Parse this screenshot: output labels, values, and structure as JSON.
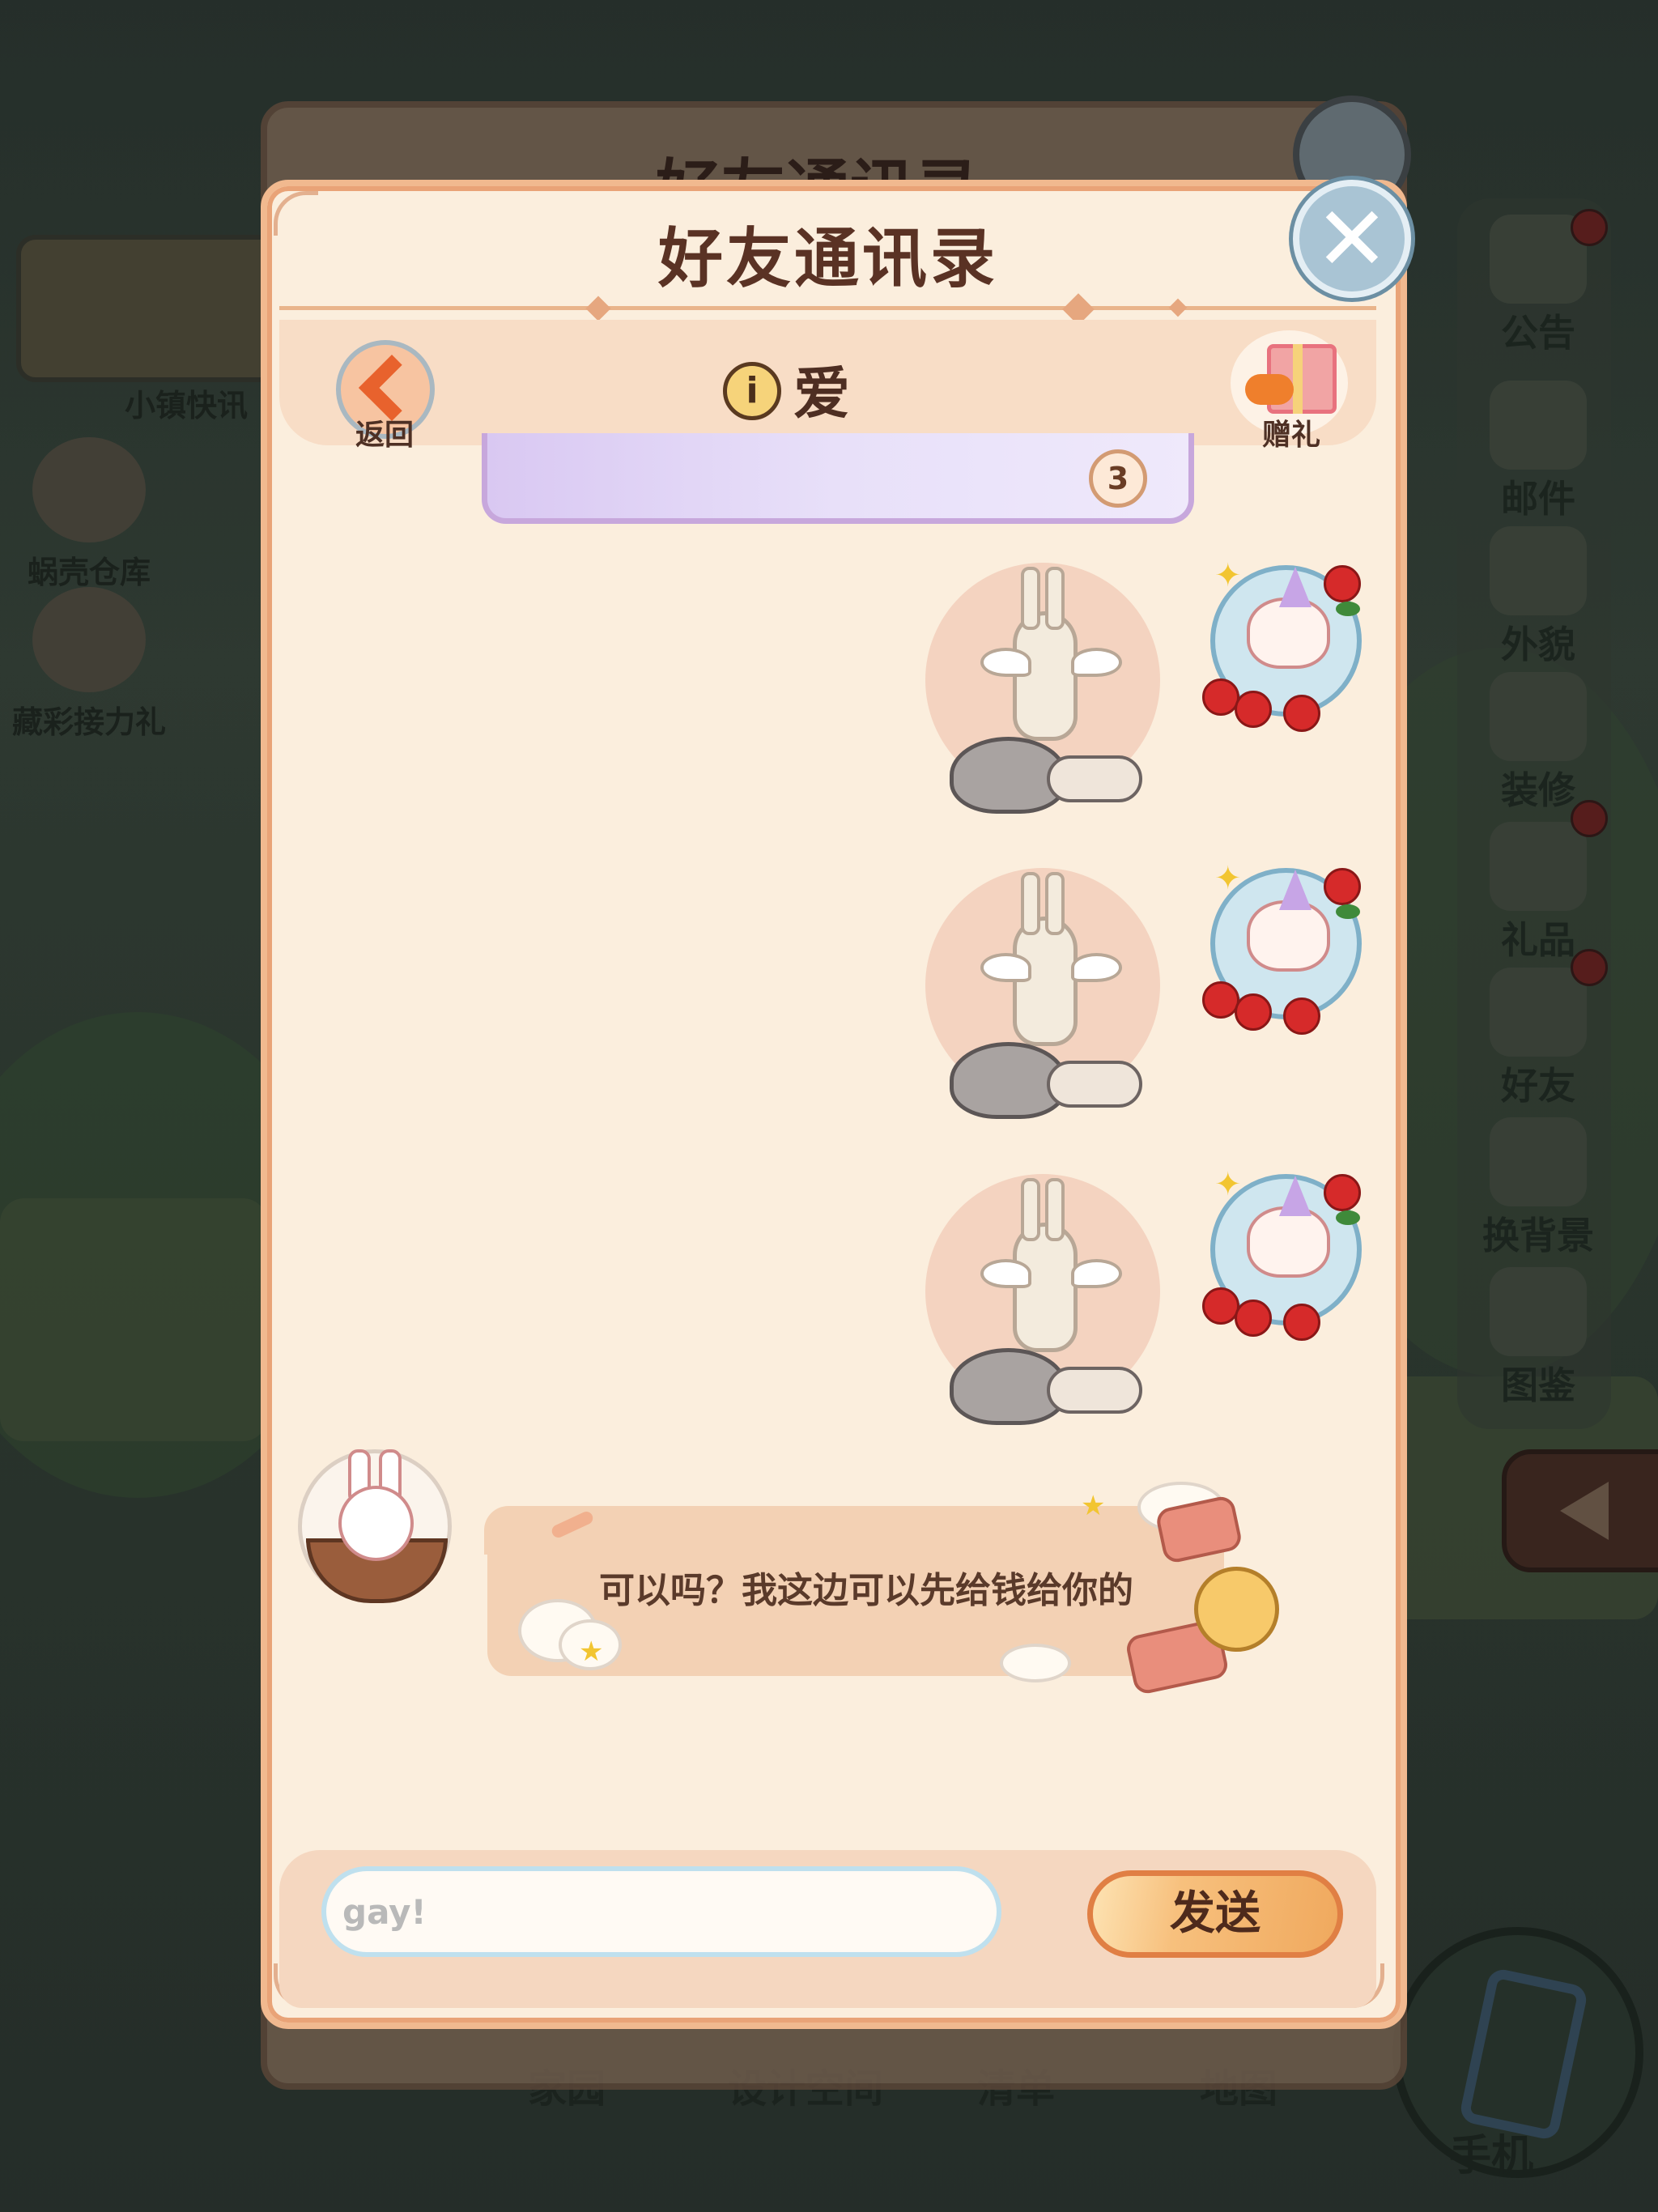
{
  "background": {
    "news_label": "小镇快讯",
    "left_items": [
      "蜗壳仓库",
      "藏彩接力礼"
    ],
    "right_rail": [
      "公告",
      "邮件",
      "外貌",
      "装修",
      "礼品",
      "好友",
      "换背景",
      "图鉴"
    ],
    "bottom_nav": [
      "家园",
      "设计空间",
      "清单",
      "地图"
    ],
    "phone_label": "手机",
    "ghost_title": "好友通讯录"
  },
  "panel": {
    "title": "好友通讯录",
    "close_symbol": "✕",
    "back_label": "返回",
    "info_symbol": "i",
    "friend_name": "爱",
    "gift_label": "赠礼"
  },
  "chat": {
    "previous_card_badge": "3",
    "sticker_messages": [
      {
        "sender": "me",
        "sticker": "winged-ghost-rock-sticker"
      },
      {
        "sender": "me",
        "sticker": "winged-ghost-rock-sticker"
      },
      {
        "sender": "me",
        "sticker": "winged-ghost-rock-sticker"
      }
    ],
    "friend_message": "可以吗？我这边可以先给钱给你的"
  },
  "composer": {
    "input_value": "gay!",
    "send_label": "发送"
  },
  "colors": {
    "panel_bg": "#fbeedd",
    "panel_border": "#f1b98f",
    "title_text": "#5a3224",
    "send_button": "#f0a95e",
    "close_button": "#a9c4d4"
  }
}
